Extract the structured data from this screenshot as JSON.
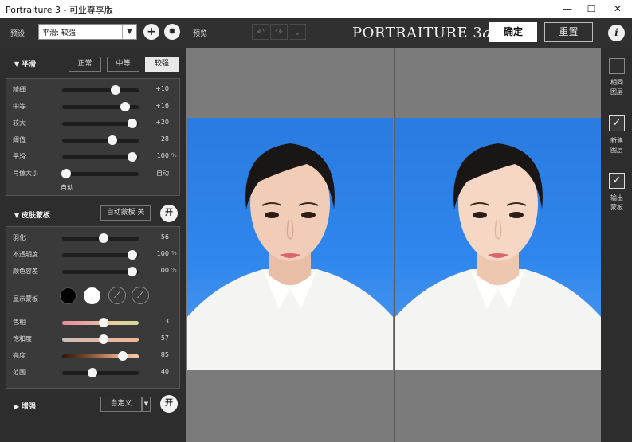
{
  "window": {
    "title": "Portraiture 3 - 可业尊享版",
    "minimize": "—",
    "maximize": "☐",
    "close": "✕"
  },
  "toolbar": {
    "preset_label": "预设",
    "preset_value": "平滑: 较强",
    "add_icon": "add-icon",
    "settings_icon": "gear-icon",
    "preview_label": "预览",
    "undo": "↶",
    "redo": "↷",
    "history": "⌄",
    "brand_main": "PORTRAITURE 3",
    "brand_suffix": "ai",
    "ok_label": "确定",
    "reset_label": "重置",
    "info_label": "i"
  },
  "smoothing": {
    "title": "平滑",
    "presets": [
      "正常",
      "中等",
      "较强"
    ],
    "selected_preset": "较强",
    "sliders": [
      {
        "name": "精细",
        "value": "+10",
        "pos": 0.7,
        "pct": ""
      },
      {
        "name": "中等",
        "value": "+16",
        "pos": 0.82,
        "pct": ""
      },
      {
        "name": "较大",
        "value": "+20",
        "pos": 0.92,
        "pct": ""
      },
      {
        "name": "阈值",
        "value": "28",
        "pos": 0.66,
        "pct": ""
      },
      {
        "name": "平滑",
        "value": "100",
        "pos": 0.92,
        "pct": "%"
      },
      {
        "name": "肖像大小",
        "value": "自动",
        "pos": 0.05,
        "pct": ""
      }
    ],
    "auto_label": "自动"
  },
  "skin_mask": {
    "title": "皮肤蒙板",
    "auto_mask_label": "自动蒙板 关",
    "on_label": "开",
    "sliders": [
      {
        "name": "羽化",
        "value": "56",
        "pos": 0.54,
        "pct": ""
      },
      {
        "name": "不透明度",
        "value": "100",
        "pos": 0.92,
        "pct": "%"
      },
      {
        "name": "颜色容差",
        "value": "100",
        "pos": 0.92,
        "pct": "%"
      }
    ],
    "show_mask_label": "显示蒙板",
    "swatch_black": "#000000",
    "swatch_white": "#ffffff",
    "picker_icon": "eyedropper-icon",
    "picker_plus_icon": "eyedropper-plus-icon",
    "color_sliders": [
      {
        "name": "色相",
        "value": "113",
        "pos": 0.54,
        "gradient": "linear-gradient(90deg,#e48fa0,#e9a7a0,#e8cf9c,#d8d69a)"
      },
      {
        "name": "饱和度",
        "value": "57",
        "pos": 0.54,
        "gradient": "linear-gradient(90deg,#c9bdb6,#e3b9a6,#f0b799)"
      },
      {
        "name": "亮度",
        "value": "85",
        "pos": 0.79,
        "gradient": "linear-gradient(90deg,#2a160e,#7a4a2f,#d69a72,#f3cdb1)"
      },
      {
        "name": "范围",
        "value": "40",
        "pos": 0.4,
        "gradient": "#1d1d1d"
      }
    ]
  },
  "enhance": {
    "title": "增强",
    "preset_value": "自定义",
    "on_label": "开"
  },
  "right_panel": {
    "items": [
      {
        "label1": "相同",
        "label2": "图层",
        "checked": false
      },
      {
        "label1": "新建",
        "label2": "图层",
        "checked": true
      },
      {
        "label1": "输出",
        "label2": "蒙板",
        "checked": true
      }
    ],
    "check_mark": "✓"
  },
  "colors": {
    "accent_white": "#ffffff",
    "panel_bg": "#2d2d2d",
    "backdrop_blue": "#2f86ec"
  }
}
